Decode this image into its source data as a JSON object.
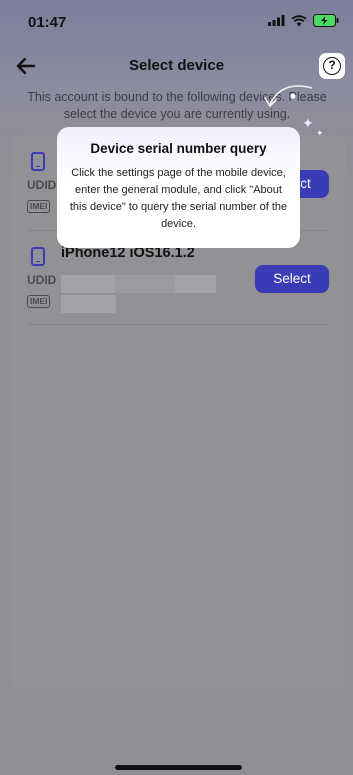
{
  "status_bar": {
    "time": "01:47"
  },
  "header": {
    "title": "Select device"
  },
  "notice": "This account is bound to the following devices. Please select the device you are currently using.",
  "devices": [
    {
      "name": "",
      "udid_label": "UDID",
      "imei_label": "IMEI",
      "select_label": "Select"
    },
    {
      "name": "iPhone12 iOS16.1.2",
      "udid_label": "UDID",
      "imei_label": "IMEI",
      "select_label": "Select"
    }
  ],
  "popup": {
    "title": "Device serial number query",
    "body": "Click the settings page of the mobile device, enter the general module, and click \"About this device\" to query the serial number of the device."
  },
  "icons": {
    "back": "arrow-left-icon",
    "help": "question-circle-icon",
    "phone": "phone-icon",
    "signal": "signal-icon",
    "wifi": "wifi-icon",
    "battery": "battery-charging-icon"
  },
  "colors": {
    "accent": "#3a3bb5",
    "battery": "#4cd964"
  }
}
